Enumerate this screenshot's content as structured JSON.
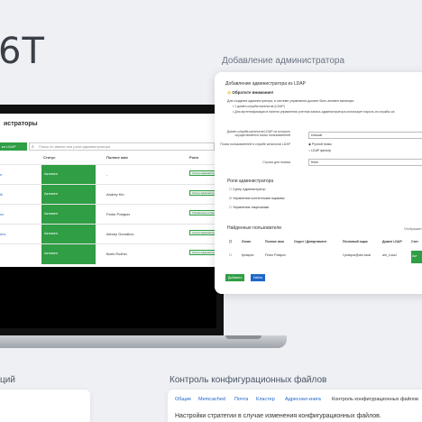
{
  "brand": "6T",
  "sections": {
    "add_admin": "Добавление администратора",
    "left_bottom": "ций",
    "config_control": "Контроль конфигурационных файлов"
  },
  "screen": {
    "title": "истраторы",
    "add_button": "из LDAP",
    "search_placeholder": "Поиск по имени или роли администратора",
    "columns": {
      "status": "Статус",
      "full_name": "Полное имя",
      "roles": "Роли"
    },
    "rows": [
      {
        "login": "n",
        "status": "Активен",
        "name": "-",
        "role": "Супер Администратор"
      },
      {
        "login": "ik",
        "status": "Активен",
        "name": "Andrey Kin",
        "role": "Супер Администратор"
      },
      {
        "login": "ov",
        "status": "Активен",
        "name": "Fedor Potapov",
        "role": "Управление пользователя"
      },
      {
        "login": "dov",
        "status": "Активен",
        "name": "Alexey Gorodkov",
        "role": "Супер Администратор"
      },
      {
        "login": "",
        "status": "Активен",
        "name": "Boris Rozhin",
        "role": "Супер Администратор"
      }
    ]
  },
  "modal": {
    "title": "Добавление администратора из LDAP",
    "warning_title": "Обратите внимание!",
    "warning_lines": [
      "Для создания администратора, в системе управления должен быть активен минимум:",
      "• 1 домен-служба каталогов (LDAP)",
      "• Для аутентификации в панели управления учетная запись администратора использует пароль из службы ка"
    ],
    "fields": {
      "domain_label": "Домен-служба каталогов LDAP из которого осуществляется поиск пользователей",
      "domain_value": "eosocal",
      "search_label": "Поиск пользователей в службе каталогов LDAP",
      "search_opt1": "Ручной поиск",
      "search_opt2": "LDAP фильтр",
      "query_label": "Строка для поиска",
      "query_value": "fedor"
    },
    "roles_title": "Роли администратора",
    "roles": [
      "Супер Администратор",
      "Управление контентными ящиками",
      "Управление лицензиями"
    ],
    "found_title": "Найденные пользователи",
    "found_right": "Отображает",
    "table_headers": [
      "Логин",
      "Полное имя",
      "Отдел / Департамент",
      "Почтовый ящик",
      "Домен LDAP",
      "Стат"
    ],
    "table_row": [
      "fpotapov",
      "Fedor Potapov",
      "",
      "f.potapov@am.local",
      "am_1oca.l",
      "Акт"
    ],
    "btn_add": "Добавить",
    "btn_find": "Найти"
  },
  "bottom": {
    "tabs": [
      "Общие",
      "Memcached",
      "Почта",
      "Кластер",
      "Адресная книга",
      "Контроль конфигурационных файлов"
    ],
    "text": "Настройки стратегии в случае изменения конфигурационных файлов."
  },
  "colors": {
    "accent_green": "#2f9e44",
    "link_blue": "#1e66c8"
  }
}
